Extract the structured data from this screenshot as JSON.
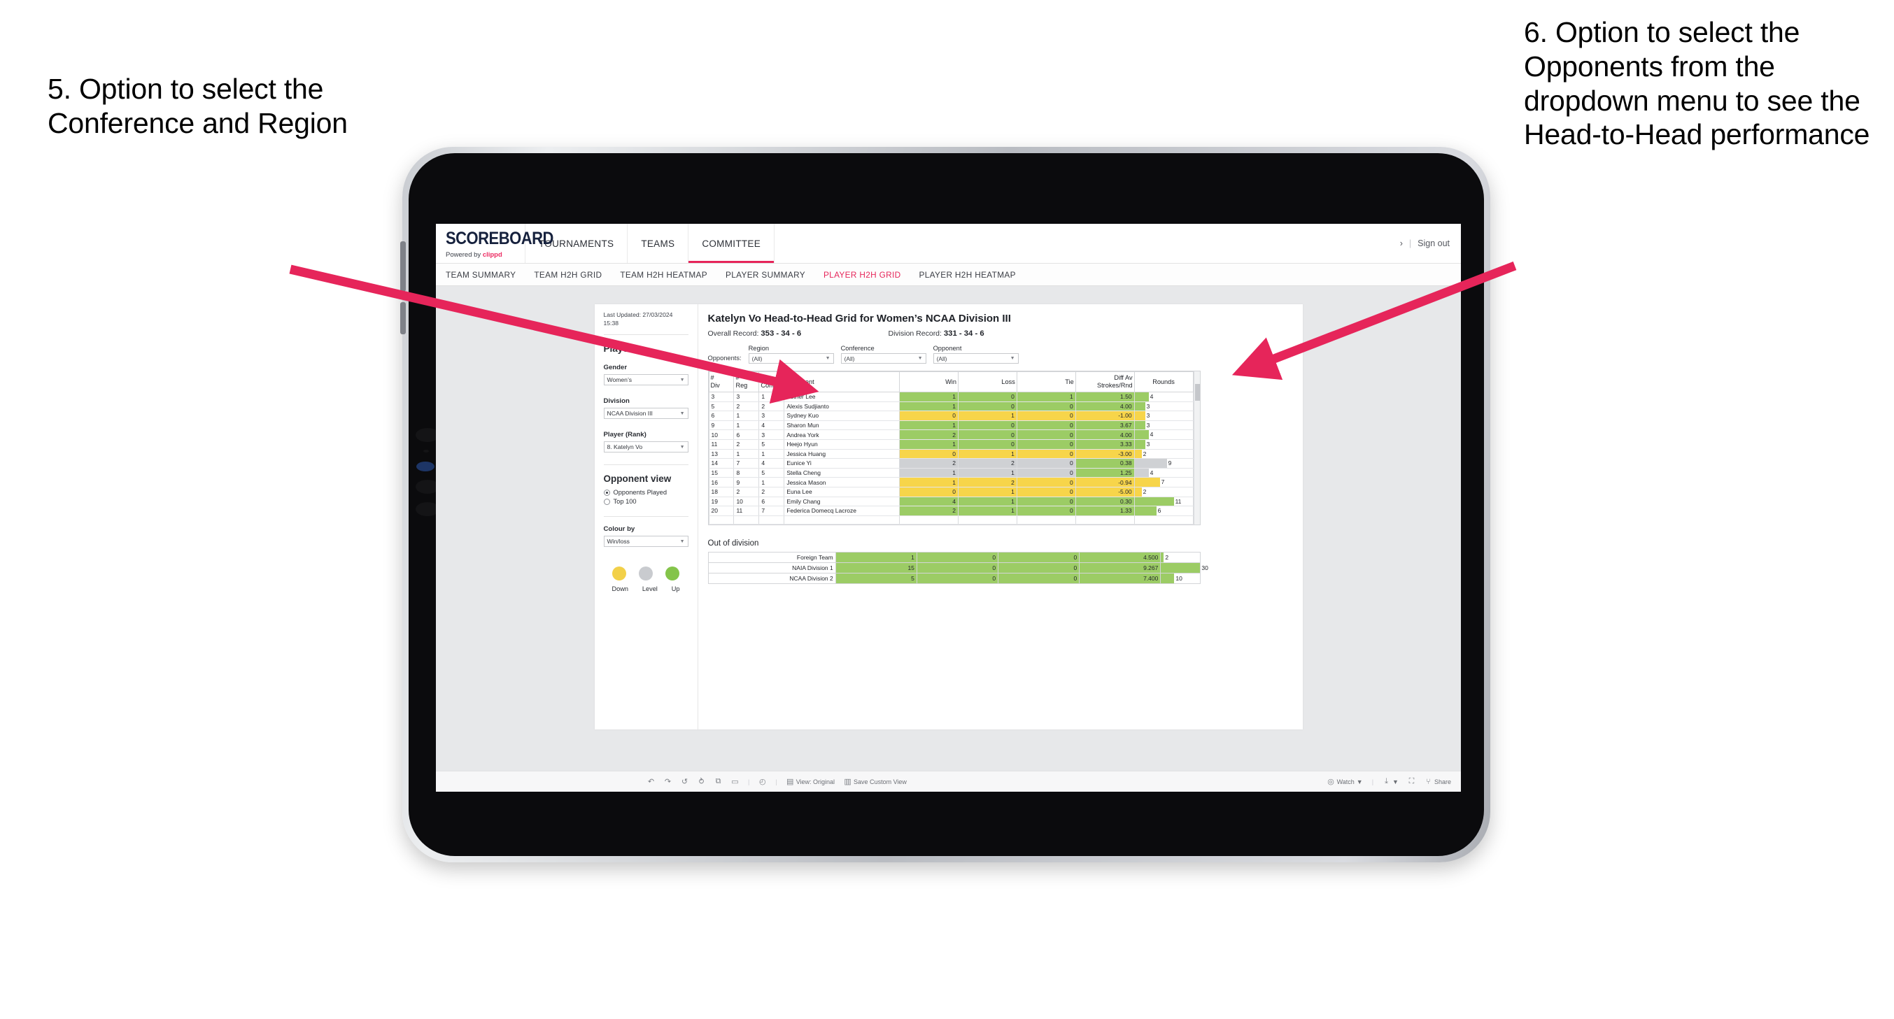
{
  "annotations": {
    "left": "5. Option to select the Conference and Region",
    "right": "6. Option to select the Opponents from the dropdown menu to see the Head-to-Head performance",
    "arrow_color": "#e6255a"
  },
  "app": {
    "logo_word": "SCOREBOARD",
    "logo_sub_prefix": "Powered by ",
    "logo_sub_brand": "clippd",
    "top_nav": [
      {
        "label": "TOURNAMENTS",
        "active": false
      },
      {
        "label": "TEAMS",
        "active": false
      },
      {
        "label": "COMMITTEE",
        "active": true
      }
    ],
    "top_right": {
      "chevron": "›",
      "divider": "|",
      "sign_out": "Sign out"
    },
    "sub_nav": [
      {
        "label": "TEAM SUMMARY",
        "active": false
      },
      {
        "label": "TEAM H2H GRID",
        "active": false
      },
      {
        "label": "TEAM H2H HEATMAP",
        "active": false
      },
      {
        "label": "PLAYER SUMMARY",
        "active": false
      },
      {
        "label": "PLAYER H2H GRID",
        "active": true
      },
      {
        "label": "PLAYER H2H HEATMAP",
        "active": false
      }
    ]
  },
  "panel": {
    "last_updated": "Last Updated: 27/03/2024 15:38",
    "section_player": "Player",
    "gender_label": "Gender",
    "gender_value": "Women’s",
    "division_label": "Division",
    "division_value": "NCAA Division III",
    "player_label": "Player (Rank)",
    "player_value": "8. Katelyn Vo",
    "opponent_view_label": "Opponent view",
    "opponent_view_options": [
      {
        "label": "Opponents Played",
        "selected": true
      },
      {
        "label": "Top 100",
        "selected": false
      }
    ],
    "colour_by_label": "Colour by",
    "colour_by_value": "Win/loss",
    "legend": [
      {
        "label": "Down",
        "color": "#f2d049"
      },
      {
        "label": "Level",
        "color": "#c9cbcf"
      },
      {
        "label": "Up",
        "color": "#84c44a"
      }
    ]
  },
  "main": {
    "title": "Katelyn Vo Head-to-Head Grid for Women’s NCAA Division III",
    "overall_record_label": "Overall Record:",
    "overall_record_value": "353 - 34 - 6",
    "division_record_label": "Division Record:",
    "division_record_value": "331 -  34 - 6",
    "opponents_label": "Opponents:",
    "filters": [
      {
        "name": "Region",
        "value": "(All)"
      },
      {
        "name": "Conference",
        "value": "(All)"
      },
      {
        "name": "Opponent",
        "value": "(All)"
      }
    ],
    "out_of_division_title": "Out of division"
  },
  "chart_data": {
    "type": "table",
    "title": "Katelyn Vo Head-to-Head Grid for Women’s NCAA Division III",
    "columns": [
      "# Div",
      "# Reg",
      "# Conf",
      "Opponent",
      "Win",
      "Loss",
      "Tie",
      "Diff Av Strokes/Rnd",
      "Rounds"
    ],
    "header_lines": [
      [
        "#",
        "Div"
      ],
      [
        "#",
        "Reg"
      ],
      [
        "#",
        "Conf"
      ],
      [
        "Opponent",
        ""
      ],
      [
        "Win",
        ""
      ],
      [
        "Loss",
        ""
      ],
      [
        "Tie",
        ""
      ],
      [
        "Diff Av",
        "Strokes/Rnd"
      ],
      [
        "Rounds",
        ""
      ]
    ],
    "rounds_max": 11,
    "rows": [
      {
        "div": "3",
        "reg": "3",
        "conf": "1",
        "opponent": "Esther Lee",
        "win": "1",
        "loss": "0",
        "tie": "1",
        "diff": "1.50",
        "rounds": "4",
        "color": "g"
      },
      {
        "div": "5",
        "reg": "2",
        "conf": "2",
        "opponent": "Alexis Sudjianto",
        "win": "1",
        "loss": "0",
        "tie": "0",
        "diff": "4.00",
        "rounds": "3",
        "color": "g"
      },
      {
        "div": "6",
        "reg": "1",
        "conf": "3",
        "opponent": "Sydney Kuo",
        "win": "0",
        "loss": "1",
        "tie": "0",
        "diff": "-1.00",
        "rounds": "3",
        "color": "y"
      },
      {
        "div": "9",
        "reg": "1",
        "conf": "4",
        "opponent": "Sharon Mun",
        "win": "1",
        "loss": "0",
        "tie": "0",
        "diff": "3.67",
        "rounds": "3",
        "color": "g"
      },
      {
        "div": "10",
        "reg": "6",
        "conf": "3",
        "opponent": "Andrea York",
        "win": "2",
        "loss": "0",
        "tie": "0",
        "diff": "4.00",
        "rounds": "4",
        "color": "g"
      },
      {
        "div": "11",
        "reg": "2",
        "conf": "5",
        "opponent": "Heejo Hyun",
        "win": "1",
        "loss": "0",
        "tie": "0",
        "diff": "3.33",
        "rounds": "3",
        "color": "g"
      },
      {
        "div": "13",
        "reg": "1",
        "conf": "1",
        "opponent": "Jessica Huang",
        "win": "0",
        "loss": "1",
        "tie": "0",
        "diff": "-3.00",
        "rounds": "2",
        "color": "y"
      },
      {
        "div": "14",
        "reg": "7",
        "conf": "4",
        "opponent": "Eunice Yi",
        "win": "2",
        "loss": "2",
        "tie": "0",
        "diff": "0.38",
        "rounds": "9",
        "color": "s",
        "diff_color": "g"
      },
      {
        "div": "15",
        "reg": "8",
        "conf": "5",
        "opponent": "Stella Cheng",
        "win": "1",
        "loss": "1",
        "tie": "0",
        "diff": "1.25",
        "rounds": "4",
        "color": "s",
        "diff_color": "g"
      },
      {
        "div": "16",
        "reg": "9",
        "conf": "1",
        "opponent": "Jessica Mason",
        "win": "1",
        "loss": "2",
        "tie": "0",
        "diff": "-0.94",
        "rounds": "7",
        "color": "y"
      },
      {
        "div": "18",
        "reg": "2",
        "conf": "2",
        "opponent": "Euna Lee",
        "win": "0",
        "loss": "1",
        "tie": "0",
        "diff": "-5.00",
        "rounds": "2",
        "color": "y"
      },
      {
        "div": "19",
        "reg": "10",
        "conf": "6",
        "opponent": "Emily Chang",
        "win": "4",
        "loss": "1",
        "tie": "0",
        "diff": "0.30",
        "rounds": "11",
        "color": "g"
      },
      {
        "div": "20",
        "reg": "11",
        "conf": "7",
        "opponent": "Federica Domecq Lacroze",
        "win": "2",
        "loss": "1",
        "tie": "0",
        "diff": "1.33",
        "rounds": "6",
        "color": "g"
      }
    ],
    "out_of_division": {
      "rounds_max": 30,
      "rows": [
        {
          "name": "Foreign Team",
          "win": "1",
          "loss": "0",
          "tie": "0",
          "diff": "4.500",
          "rounds": "2",
          "color": "g"
        },
        {
          "name": "NAIA Division 1",
          "win": "15",
          "loss": "0",
          "tie": "0",
          "diff": "9.267",
          "rounds": "30",
          "color": "g"
        },
        {
          "name": "NCAA Division 2",
          "win": "5",
          "loss": "0",
          "tie": "0",
          "diff": "7.400",
          "rounds": "10",
          "color": "g"
        }
      ]
    }
  },
  "toolbar": {
    "left_items": [
      {
        "icon": "↶",
        "label": "",
        "name": "undo-icon"
      },
      {
        "icon": "↷",
        "label": "",
        "name": "redo-icon"
      },
      {
        "icon": "↺",
        "label": "",
        "name": "revert-icon"
      },
      {
        "icon": "⥁",
        "label": "",
        "name": "refresh-icon"
      },
      {
        "icon": "⧉",
        "label": "",
        "name": "pause-icon"
      },
      {
        "icon": "▭",
        "label": "",
        "name": "shape-dropdown-icon"
      }
    ],
    "clock_icon": "◴",
    "view_label": "View: Original",
    "view_icon": "▤",
    "save_label": "Save Custom View",
    "save_icon": "▥",
    "watch_label": "Watch",
    "watch_icon": "◎",
    "download_icon": "⤓",
    "fullscreen_icon": "⛶",
    "share_label": "Share",
    "share_icon": "⑂"
  }
}
